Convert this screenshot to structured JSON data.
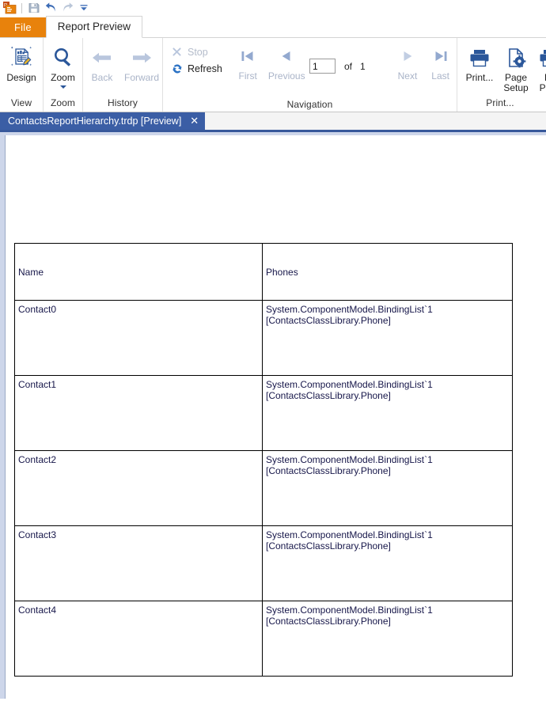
{
  "quick_access": {
    "app_icon": "report-app-icon",
    "buttons": [
      {
        "name": "save-button",
        "icon": "save-icon",
        "title": "Save"
      },
      {
        "name": "undo-button",
        "icon": "undo-icon",
        "title": "Undo"
      },
      {
        "name": "redo-button",
        "icon": "redo-icon",
        "title": "Redo"
      },
      {
        "name": "customize-qat-button",
        "icon": "chevron-down-icon",
        "title": "Customize Quick Access Toolbar"
      }
    ]
  },
  "ribbon": {
    "tabs": [
      {
        "label": "File",
        "active": false,
        "style": "file"
      },
      {
        "label": "Report Preview",
        "active": true,
        "style": "normal"
      }
    ],
    "groups": [
      {
        "label": "View",
        "items": [
          {
            "label": "Design",
            "icon": "design-report-icon",
            "enabled": true,
            "dropdown": false
          }
        ]
      },
      {
        "label": "Zoom",
        "items": [
          {
            "label": "Zoom",
            "icon": "magnifier-icon",
            "enabled": true,
            "dropdown": true
          }
        ]
      },
      {
        "label": "History",
        "items": [
          {
            "label": "Back",
            "icon": "arrow-left-icon",
            "enabled": false,
            "dropdown": false
          },
          {
            "label": "Forward",
            "icon": "arrow-right-icon",
            "enabled": false,
            "dropdown": false
          }
        ]
      },
      {
        "label": "Navigation",
        "items": [
          {
            "label": "Stop",
            "icon": "close-x-icon",
            "enabled": false
          },
          {
            "label": "Refresh",
            "icon": "refresh-icon",
            "enabled": true
          },
          {
            "label": "First",
            "icon": "first-page-icon",
            "enabled": false
          },
          {
            "label": "Previous",
            "icon": "previous-page-icon",
            "enabled": false
          },
          {
            "label": "Next",
            "icon": "next-page-icon",
            "enabled": false
          },
          {
            "label": "Last",
            "icon": "last-page-icon",
            "enabled": false
          }
        ],
        "page_input_value": "1",
        "of_label": "of",
        "total_pages": "1"
      },
      {
        "label": "Print...",
        "items": [
          {
            "label": "Print...",
            "icon": "printer-icon",
            "enabled": true
          },
          {
            "label": "Page\nSetup",
            "line1": "Page",
            "line2": "Setup",
            "icon": "page-setup-icon",
            "enabled": true
          },
          {
            "label": "Print Preview",
            "line1": "Pr",
            "line2": "Prev",
            "icon": "print-preview-icon",
            "enabled": true
          }
        ]
      }
    ]
  },
  "document_tabs": [
    {
      "title": "ContactsReportHierarchy.trdp [Preview]",
      "close": "✕",
      "active": true
    }
  ],
  "report": {
    "columns": [
      "Name",
      "Phones"
    ],
    "rows": [
      {
        "name": "Contact0",
        "phones_line1": "System.ComponentModel.BindingList`1",
        "phones_line2": "[ContactsClassLibrary.Phone]"
      },
      {
        "name": "Contact1",
        "phones_line1": "System.ComponentModel.BindingList`1",
        "phones_line2": "[ContactsClassLibrary.Phone]"
      },
      {
        "name": "Contact2",
        "phones_line1": "System.ComponentModel.BindingList`1",
        "phones_line2": "[ContactsClassLibrary.Phone]"
      },
      {
        "name": "Contact3",
        "phones_line1": "System.ComponentModel.BindingList`1",
        "phones_line2": "[ContactsClassLibrary.Phone]"
      },
      {
        "name": "Contact4",
        "phones_line1": "System.ComponentModel.BindingList`1",
        "phones_line2": "[ContactsClassLibrary.Phone]"
      }
    ]
  },
  "colors": {
    "file_tab": "#E8820C",
    "accent_blue": "#2B579A",
    "doc_tab_bg": "#3B5EA5",
    "preview_bg": "#CDD6EA",
    "disabled_text": "#B4BCCB",
    "report_text": "#17174A"
  }
}
